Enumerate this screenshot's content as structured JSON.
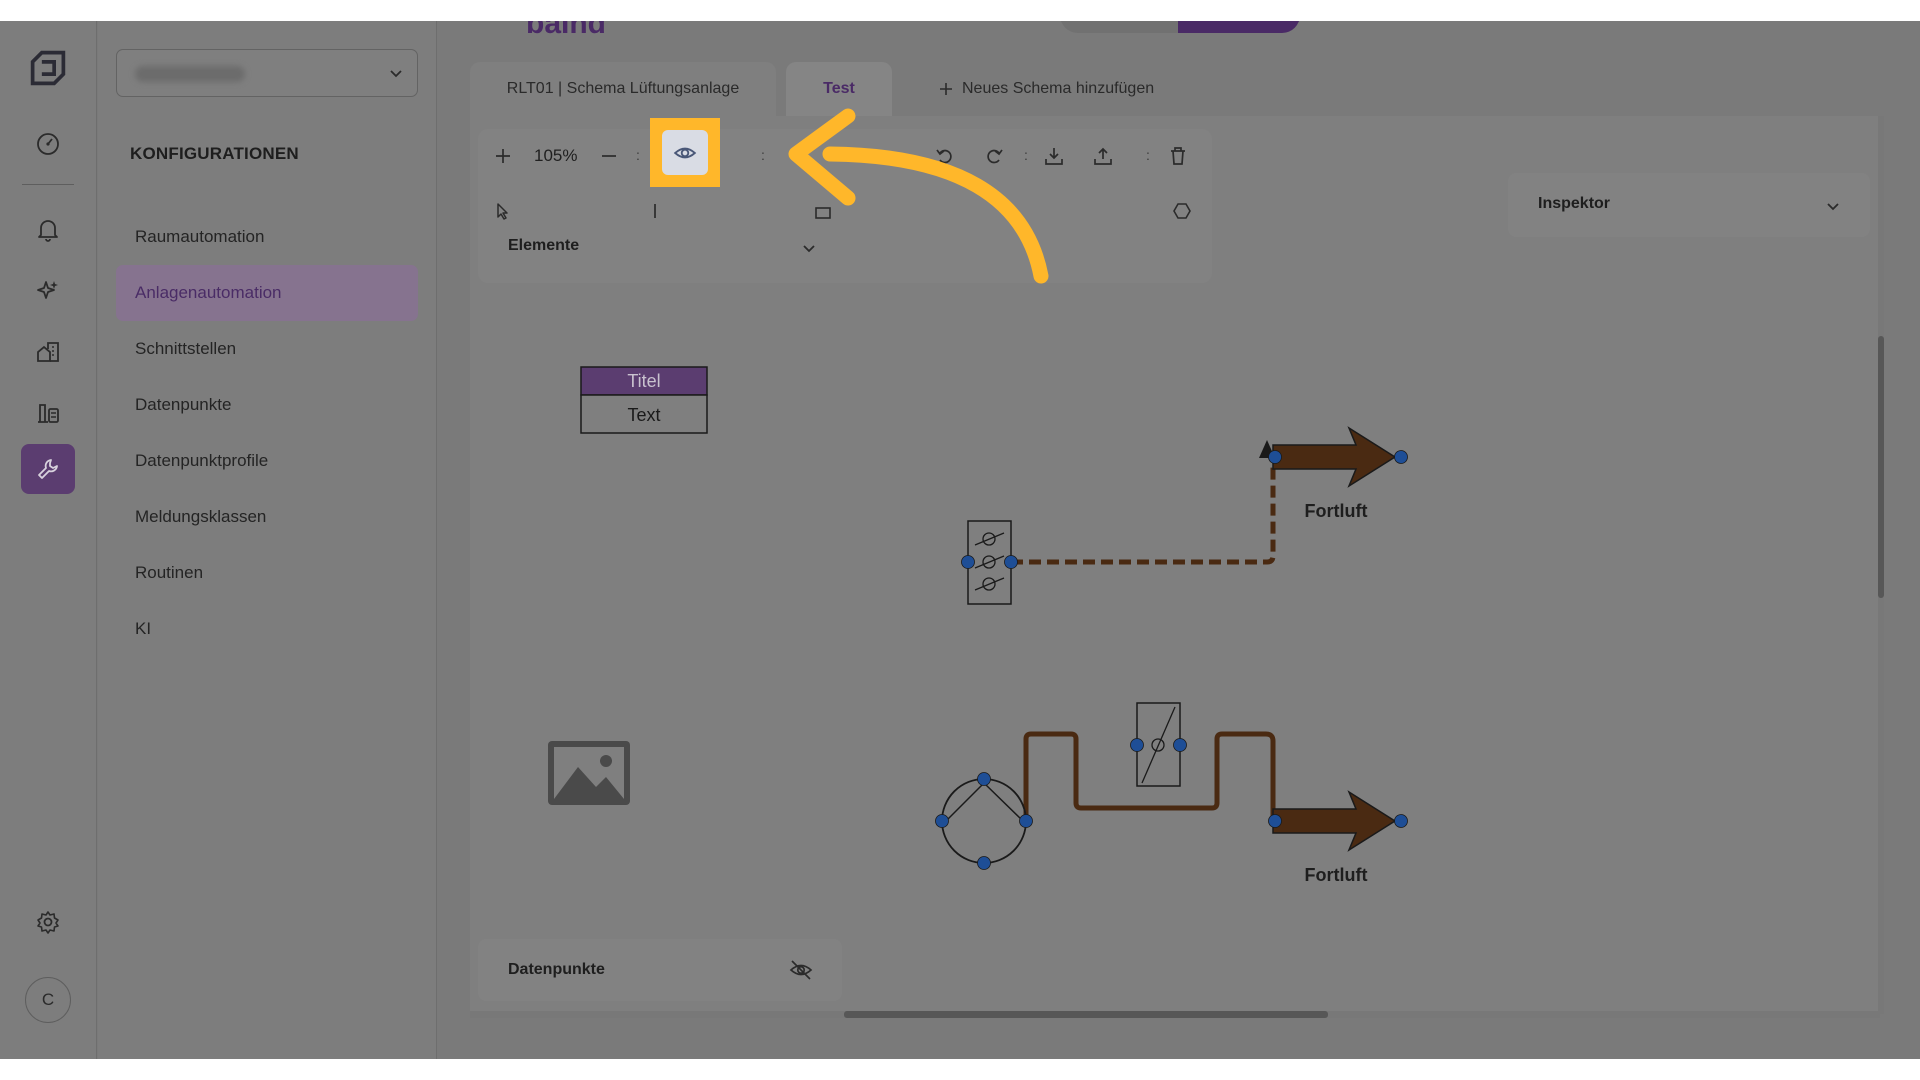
{
  "brand": {
    "text": "baInd"
  },
  "sidebar": {
    "heading": "KONFIGURATIONEN",
    "items": [
      {
        "label": "Raumautomation"
      },
      {
        "label": "Anlagenautomation",
        "active": true
      },
      {
        "label": "Schnittstellen"
      },
      {
        "label": "Datenpunkte"
      },
      {
        "label": "Datenpunktprofile"
      },
      {
        "label": "Meldungsklassen"
      },
      {
        "label": "Routinen"
      },
      {
        "label": "KI"
      }
    ]
  },
  "rail": {
    "avatar": "C",
    "icons": [
      "logo-icon",
      "dashboard-icon",
      "bell-icon",
      "sparkles-icon",
      "buildings-icon",
      "devices-icon",
      "wrench-icon",
      "settings-icon"
    ]
  },
  "tabs": [
    {
      "label": "RLT01 | Schema Lüftungsanlage"
    },
    {
      "label": "Test",
      "active": true
    },
    {
      "label": "Neues Schema hinzufügen"
    }
  ],
  "toolbar": {
    "zoom": "105%",
    "elements_label": "Elemente"
  },
  "inspector": {
    "label": "Inspektor"
  },
  "datapoints_panel": {
    "label": "Datenpunkte"
  },
  "canvas": {
    "text_box": {
      "title": "Titel",
      "text": "Text"
    },
    "outlet_labels": [
      "Fortluft",
      "Fortluft"
    ]
  },
  "colors": {
    "accent": "#4a2a66",
    "highlight": "#ffb72a",
    "duct": "#4a2a12",
    "node": "#1e4e96"
  }
}
